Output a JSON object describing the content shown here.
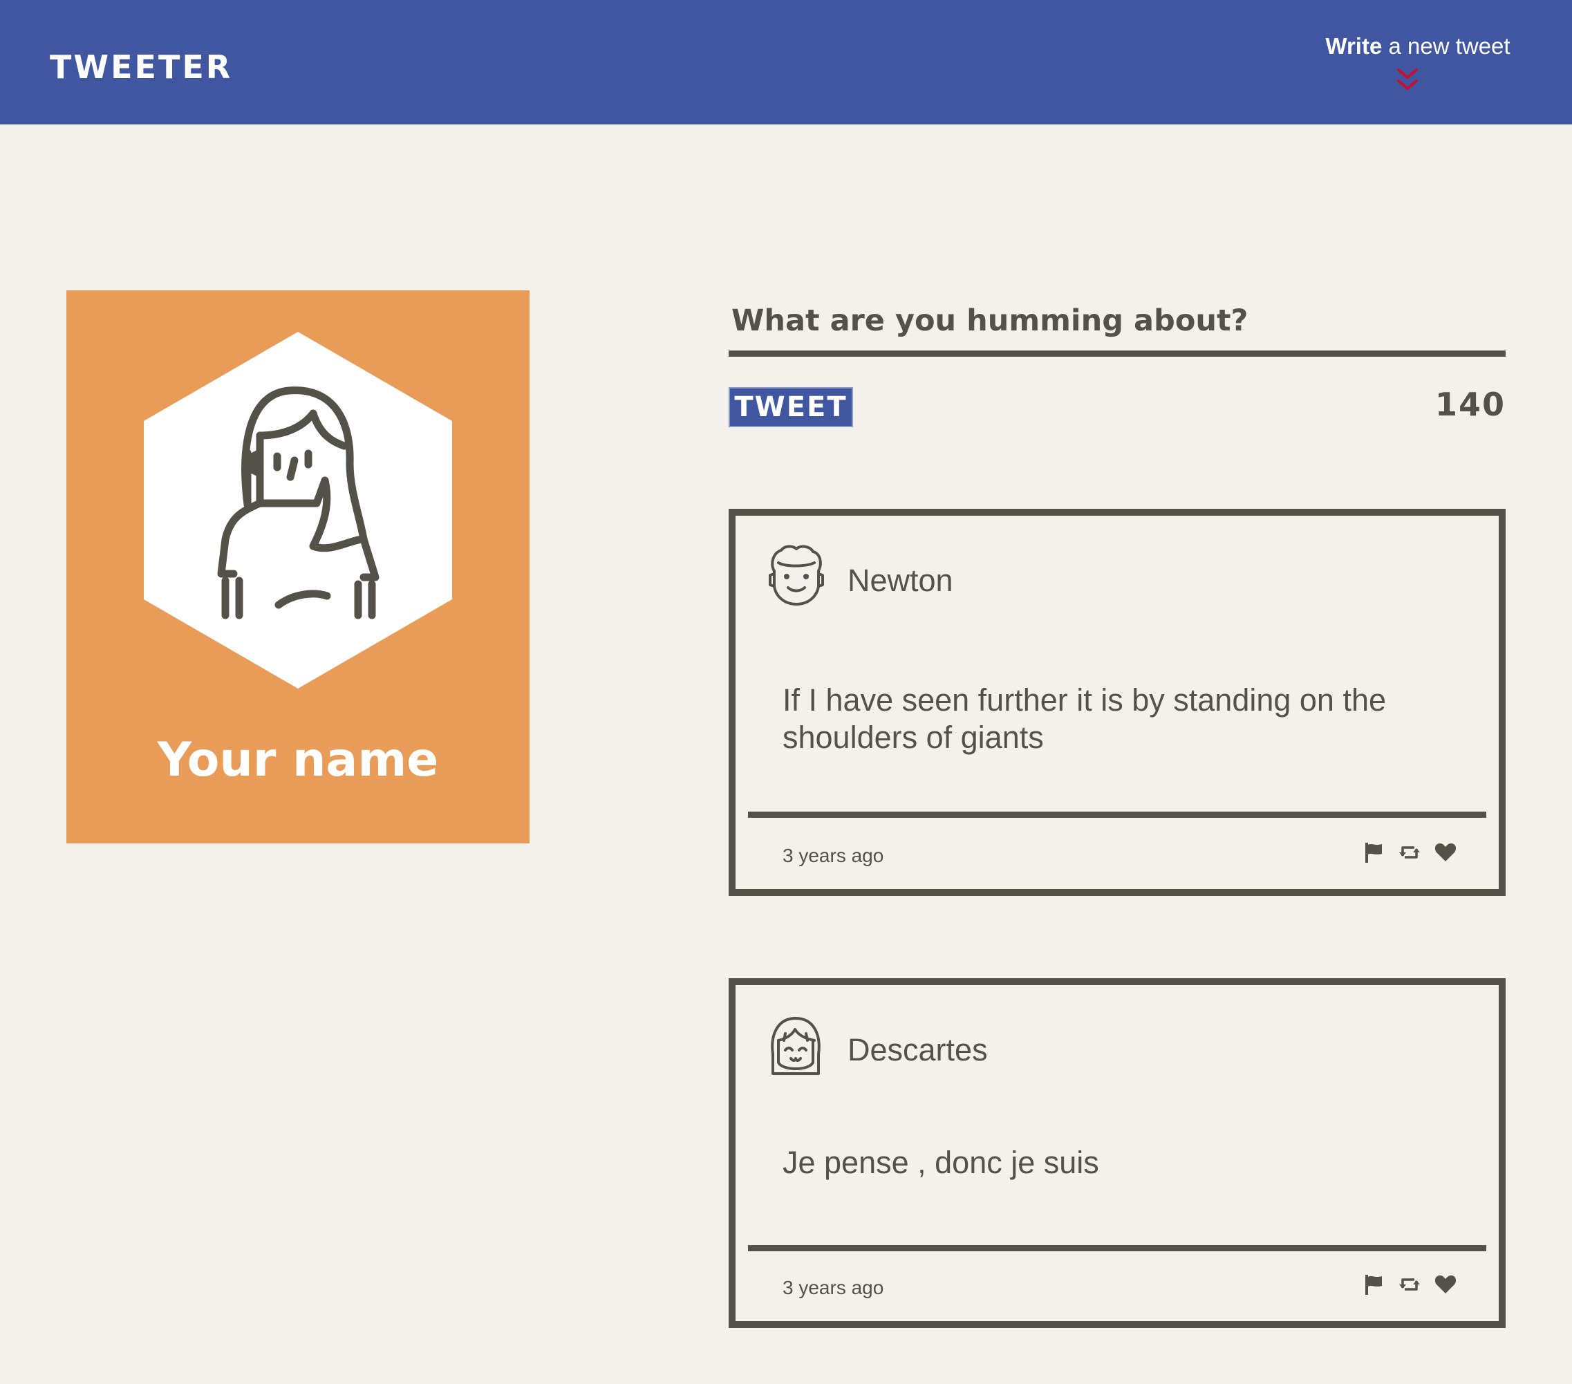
{
  "header": {
    "logo": "TWEETER",
    "compose_bold": "Write",
    "compose_rest": " a new tweet",
    "colors": {
      "bar": "#4056a1",
      "chevron": "#c8102e"
    }
  },
  "profile": {
    "name": "Your name",
    "avatar_icon": "woman-avatar-icon",
    "card_color": "#e99c57"
  },
  "composer": {
    "placeholder": "What are you humming about?",
    "button_label": "TWEET",
    "counter": "140"
  },
  "tweets": [
    {
      "author": "Newton",
      "avatar_icon": "curly-hair-man-avatar-icon",
      "text": "If I have seen further it is by standing on the shoulders of giants",
      "time": "3 years ago"
    },
    {
      "author": "Descartes",
      "avatar_icon": "bangs-hair-avatar-icon",
      "text": "Je pense , donc je suis",
      "time": "3 years ago"
    }
  ],
  "actions": [
    "flag-icon",
    "retweet-icon",
    "heart-icon"
  ],
  "colors": {
    "background": "#f4f1ec",
    "ink": "#545149"
  }
}
